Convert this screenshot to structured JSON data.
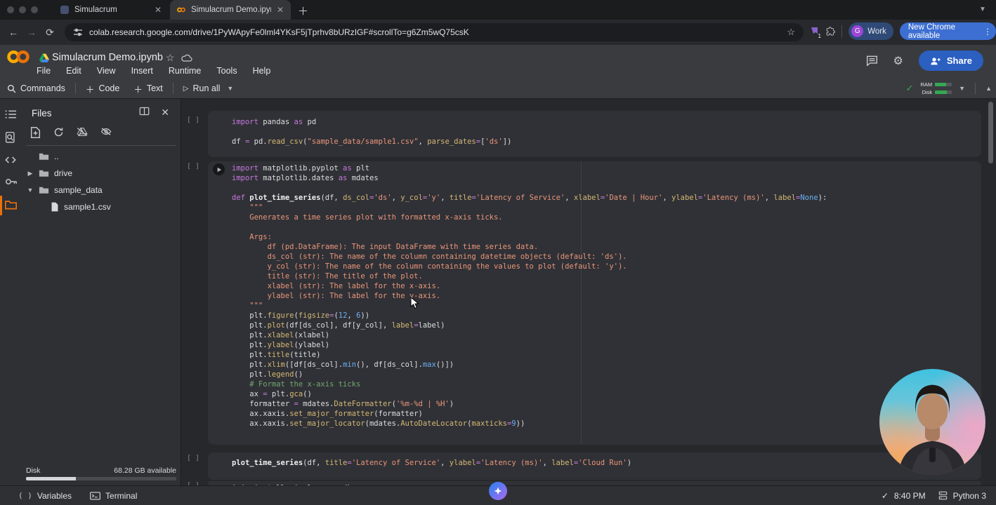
{
  "colors": {
    "accent_blue": "#3d6fd2",
    "colab_orange": "#e8710a",
    "run_green": "#34a853",
    "share_blue": "#2b5fc0"
  },
  "browser": {
    "tabs": [
      {
        "title": "Simulacrum"
      },
      {
        "title": "Simulacrum Demo.ipynb - Co"
      }
    ],
    "url": "colab.research.google.com/drive/1PyWApyFe0lml4YKsF5jTprhv8bURzIGF#scrollTo=g6Zm5wQ75csK",
    "extension_badge": "1",
    "profile_label": "Work",
    "profile_initial": "G",
    "update_button": "New Chrome available"
  },
  "header": {
    "title": "Simulacrum Demo.ipynb",
    "menus": [
      "File",
      "Edit",
      "View",
      "Insert",
      "Runtime",
      "Tools",
      "Help"
    ],
    "share_label": "Share"
  },
  "toolbar": {
    "commands_label": "Commands",
    "code_label": "Code",
    "text_label": "Text",
    "run_all_label": "Run all",
    "ram_label": "RAM",
    "disk_label": "Disk"
  },
  "sidebar": {
    "title": "Files",
    "tree": [
      {
        "label": "..",
        "type": "folder"
      },
      {
        "label": "drive",
        "type": "folder",
        "state": "collapsed"
      },
      {
        "label": "sample_data",
        "type": "folder",
        "state": "expanded"
      },
      {
        "label": "sample1.csv",
        "type": "file"
      }
    ],
    "disk_label": "Disk",
    "disk_available": "68.28 GB available"
  },
  "cells": [
    {
      "gutter": "[ ]",
      "lines": [
        [
          [
            "kw",
            "import"
          ],
          [
            "t",
            " pandas "
          ],
          [
            "kw",
            "as"
          ],
          [
            "t",
            " pd"
          ]
        ],
        [],
        [
          [
            "t",
            "df "
          ],
          [
            "op",
            "="
          ],
          [
            "t",
            " pd."
          ],
          [
            "call",
            "read_csv"
          ],
          [
            "t",
            "("
          ],
          [
            "str",
            "\"sample_data/sample1.csv\""
          ],
          [
            "t",
            ", "
          ],
          [
            "pm",
            "parse_dates"
          ],
          [
            "op",
            "="
          ],
          [
            "t",
            "["
          ],
          [
            "str",
            "'ds'"
          ],
          [
            "t",
            "])"
          ]
        ]
      ]
    },
    {
      "gutter": "[ ]",
      "lines": [
        [
          [
            "kw",
            "import"
          ],
          [
            "t",
            " matplotlib.pyplot "
          ],
          [
            "kw",
            "as"
          ],
          [
            "t",
            " plt"
          ]
        ],
        [
          [
            "kw",
            "import"
          ],
          [
            "t",
            " matplotlib.dates "
          ],
          [
            "kw",
            "as"
          ],
          [
            "t",
            " mdates"
          ]
        ],
        [],
        [
          [
            "kw",
            "def"
          ],
          [
            "t",
            " "
          ],
          [
            "fnd",
            "plot_time_series"
          ],
          [
            "t",
            "(df, "
          ],
          [
            "pm",
            "ds_col"
          ],
          [
            "op",
            "="
          ],
          [
            "str",
            "'ds'"
          ],
          [
            "t",
            ", "
          ],
          [
            "pm",
            "y_col"
          ],
          [
            "op",
            "="
          ],
          [
            "str",
            "'y'"
          ],
          [
            "t",
            ", "
          ],
          [
            "pm",
            "title"
          ],
          [
            "op",
            "="
          ],
          [
            "str",
            "'Latency of Service'"
          ],
          [
            "t",
            ", "
          ],
          [
            "pm",
            "xlabel"
          ],
          [
            "op",
            "="
          ],
          [
            "str",
            "'Date | Hour'"
          ],
          [
            "t",
            ", "
          ],
          [
            "pm",
            "ylabel"
          ],
          [
            "op",
            "="
          ],
          [
            "str",
            "'Latency (ms)'"
          ],
          [
            "t",
            ", "
          ],
          [
            "pm",
            "label"
          ],
          [
            "op",
            "="
          ],
          [
            "blt",
            "None"
          ],
          [
            "t",
            "):"
          ]
        ],
        [
          [
            "doc",
            "    \"\"\""
          ]
        ],
        [
          [
            "doc",
            "    Generates a time series plot with formatted x-axis ticks."
          ]
        ],
        [],
        [
          [
            "doc",
            "    Args:"
          ]
        ],
        [
          [
            "doc",
            "        df (pd.DataFrame): The input DataFrame with time series data."
          ]
        ],
        [
          [
            "doc",
            "        ds_col (str): The name of the column containing datetime objects (default: 'ds')."
          ]
        ],
        [
          [
            "doc",
            "        y_col (str): The name of the column containing the values to plot (default: 'y')."
          ]
        ],
        [
          [
            "doc",
            "        title (str): The title of the plot."
          ]
        ],
        [
          [
            "doc",
            "        xlabel (str): The label for the x-axis."
          ]
        ],
        [
          [
            "doc",
            "        ylabel (str): The label for the y-axis."
          ]
        ],
        [
          [
            "doc",
            "    \"\"\""
          ]
        ],
        [
          [
            "t",
            "    plt."
          ],
          [
            "call",
            "figure"
          ],
          [
            "t",
            "("
          ],
          [
            "pm",
            "figsize"
          ],
          [
            "op",
            "="
          ],
          [
            "t",
            "("
          ],
          [
            "num",
            "12"
          ],
          [
            "t",
            ", "
          ],
          [
            "num",
            "6"
          ],
          [
            "t",
            "))"
          ]
        ],
        [
          [
            "t",
            "    plt."
          ],
          [
            "call",
            "plot"
          ],
          [
            "t",
            "(df[ds_col], df[y_col], "
          ],
          [
            "pm",
            "label"
          ],
          [
            "op",
            "="
          ],
          [
            "t",
            "label)"
          ]
        ],
        [
          [
            "t",
            "    plt."
          ],
          [
            "call",
            "xlabel"
          ],
          [
            "t",
            "(xlabel)"
          ]
        ],
        [
          [
            "t",
            "    plt."
          ],
          [
            "call",
            "ylabel"
          ],
          [
            "t",
            "(ylabel)"
          ]
        ],
        [
          [
            "t",
            "    plt."
          ],
          [
            "call",
            "title"
          ],
          [
            "t",
            "(title)"
          ]
        ],
        [
          [
            "t",
            "    plt."
          ],
          [
            "call",
            "xlim"
          ],
          [
            "t",
            "([df[ds_col]."
          ],
          [
            "blt",
            "min"
          ],
          [
            "t",
            "(), df[ds_col]."
          ],
          [
            "blt",
            "max"
          ],
          [
            "t",
            "()])"
          ]
        ],
        [
          [
            "t",
            "    plt."
          ],
          [
            "call",
            "legend"
          ],
          [
            "t",
            "()"
          ]
        ],
        [
          [
            "com",
            "    # Format the x-axis ticks"
          ]
        ],
        [
          [
            "t",
            "    ax "
          ],
          [
            "op",
            "="
          ],
          [
            "t",
            " plt."
          ],
          [
            "call",
            "gca"
          ],
          [
            "t",
            "()"
          ]
        ],
        [
          [
            "t",
            "    formatter "
          ],
          [
            "op",
            "="
          ],
          [
            "t",
            " mdates."
          ],
          [
            "call",
            "DateFormatter"
          ],
          [
            "t",
            "("
          ],
          [
            "str",
            "'%m-%d | %H'"
          ],
          [
            "t",
            ")"
          ]
        ],
        [
          [
            "t",
            "    ax.xaxis."
          ],
          [
            "call",
            "set_major_formatter"
          ],
          [
            "t",
            "(formatter)"
          ]
        ],
        [
          [
            "t",
            "    ax.xaxis."
          ],
          [
            "call",
            "set_major_locator"
          ],
          [
            "t",
            "(mdates."
          ],
          [
            "call",
            "AutoDateLocator"
          ],
          [
            "t",
            "("
          ],
          [
            "pm",
            "maxticks"
          ],
          [
            "op",
            "="
          ],
          [
            "num",
            "9"
          ],
          [
            "t",
            "))"
          ]
        ]
      ]
    },
    {
      "gutter": "[ ]",
      "lines": [
        [
          [
            "fnd",
            "plot_time_series"
          ],
          [
            "t",
            "(df, "
          ],
          [
            "pm",
            "title"
          ],
          [
            "op",
            "="
          ],
          [
            "str",
            "'Latency of Service'"
          ],
          [
            "t",
            ", "
          ],
          [
            "pm",
            "ylabel"
          ],
          [
            "op",
            "="
          ],
          [
            "str",
            "'Latency (ms)'"
          ],
          [
            "t",
            ", "
          ],
          [
            "pm",
            "label"
          ],
          [
            "op",
            "="
          ],
          [
            "str",
            "'Cloud Run'"
          ],
          [
            "t",
            ")"
          ]
        ]
      ]
    },
    {
      "gutter": "[ ]",
      "lines": [
        [
          [
            "t",
            "!pip install simulacrum sdk"
          ]
        ]
      ]
    }
  ],
  "statusbar": {
    "variables_label": "Variables",
    "terminal_label": "Terminal",
    "time": "8:40 PM",
    "kernel": "Python 3"
  }
}
